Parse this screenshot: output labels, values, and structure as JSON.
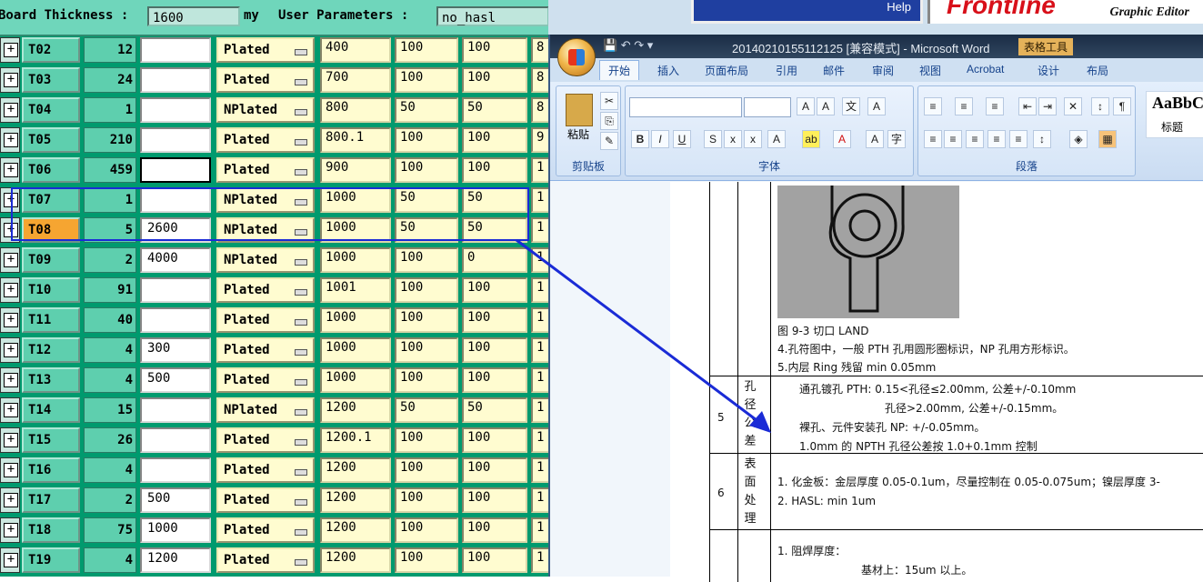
{
  "header": {
    "board_label": "Board Thickness :",
    "board_value": "1600",
    "unit": "my",
    "userparam_label": "User Parameters :",
    "userparam_value": "no_hasl"
  },
  "rows": [
    {
      "tool": "T02",
      "count": "12",
      "val": "",
      "plated": "Plated",
      "n1": "400",
      "n2": "100",
      "n3": "100",
      "n4": "8"
    },
    {
      "tool": "T03",
      "count": "24",
      "val": "",
      "plated": "Plated",
      "n1": "700",
      "n2": "100",
      "n3": "100",
      "n4": "8"
    },
    {
      "tool": "T04",
      "count": "1",
      "val": "",
      "plated": "NPlated",
      "n1": "800",
      "n2": "50",
      "n3": "50",
      "n4": "8"
    },
    {
      "tool": "T05",
      "count": "210",
      "val": "",
      "plated": "Plated",
      "n1": "800.1",
      "n2": "100",
      "n3": "100",
      "n4": "9"
    },
    {
      "tool": "T06",
      "count": "459",
      "val": "",
      "plated": "Plated",
      "n1": "900",
      "n2": "100",
      "n3": "100",
      "n4": "1"
    },
    {
      "tool": "T07",
      "count": "1",
      "val": "",
      "plated": "NPlated",
      "n1": "1000",
      "n2": "50",
      "n3": "50",
      "n4": "1"
    },
    {
      "tool": "T08",
      "count": "5",
      "val": "2600",
      "plated": "NPlated",
      "n1": "1000",
      "n2": "50",
      "n3": "50",
      "n4": "1"
    },
    {
      "tool": "T09",
      "count": "2",
      "val": "4000",
      "plated": "NPlated",
      "n1": "1000",
      "n2": "100",
      "n3": "0",
      "n4": "1"
    },
    {
      "tool": "T10",
      "count": "91",
      "val": "",
      "plated": "Plated",
      "n1": "1001",
      "n2": "100",
      "n3": "100",
      "n4": "1"
    },
    {
      "tool": "T11",
      "count": "40",
      "val": "",
      "plated": "Plated",
      "n1": "1000",
      "n2": "100",
      "n3": "100",
      "n4": "1"
    },
    {
      "tool": "T12",
      "count": "4",
      "val": "300",
      "plated": "Plated",
      "n1": "1000",
      "n2": "100",
      "n3": "100",
      "n4": "1"
    },
    {
      "tool": "T13",
      "count": "4",
      "val": "500",
      "plated": "Plated",
      "n1": "1000",
      "n2": "100",
      "n3": "100",
      "n4": "1"
    },
    {
      "tool": "T14",
      "count": "15",
      "val": "",
      "plated": "NPlated",
      "n1": "1200",
      "n2": "50",
      "n3": "50",
      "n4": "1"
    },
    {
      "tool": "T15",
      "count": "26",
      "val": "",
      "plated": "Plated",
      "n1": "1200.1",
      "n2": "100",
      "n3": "100",
      "n4": "1"
    },
    {
      "tool": "T16",
      "count": "4",
      "val": "",
      "plated": "Plated",
      "n1": "1200",
      "n2": "100",
      "n3": "100",
      "n4": "1"
    },
    {
      "tool": "T17",
      "count": "2",
      "val": "500",
      "plated": "Plated",
      "n1": "1200",
      "n2": "100",
      "n3": "100",
      "n4": "1"
    },
    {
      "tool": "T18",
      "count": "75",
      "val": "1000",
      "plated": "Plated",
      "n1": "1200",
      "n2": "100",
      "n3": "100",
      "n4": "1"
    },
    {
      "tool": "T19",
      "count": "4",
      "val": "1200",
      "plated": "Plated",
      "n1": "1200",
      "n2": "100",
      "n3": "100",
      "n4": "1"
    }
  ],
  "top_right": {
    "help": "Help",
    "brand": "Frontline",
    "editor": "Graphic Editor"
  },
  "word": {
    "title": "20140210155112125 [兼容模式] - Microsoft Word",
    "table_tools": "表格工具",
    "tabs": [
      "开始",
      "插入",
      "页面布局",
      "引用",
      "邮件",
      "审阅",
      "视图",
      "Acrobat",
      "设计",
      "布局"
    ],
    "groups": {
      "clipboard": "剪贴板",
      "font": "字体",
      "paragraph": "段落",
      "paste": "粘贴",
      "style_sample": "AaBbC",
      "style_name": "标题"
    },
    "doc": {
      "fig_caption": "图 9-3 切口 LAND",
      "line4": "4.孔符图中，一般 PTH 孔用圆形圈标识，NP 孔用方形标识。",
      "line5": "5.内层 Ring 残留 min 0.05mm",
      "row5_no": "5",
      "row5_title": "孔径公差",
      "row5_l1": "通孔镀孔 PTH: 0.15<孔径≤2.00mm, 公差+/-0.10mm",
      "row5_l2": "孔径>2.00mm, 公差+/-0.15mm。",
      "row5_l3": "裸孔、元件安装孔 NP: +/-0.05mm。",
      "row5_l4": "1.0mm 的 NPTH 孔径公差按 1.0+0.1mm 控制",
      "row6_no": "6",
      "row6_title": "表面处理",
      "row6_l1": "1.  化金板：金层厚度 0.05-0.1um，尽量控制在 0.05-0.075um；镍层厚度 3-",
      "row6_l2": "2.  HASL: min 1um",
      "row7_l1": "1.  阻焊厚度：",
      "row7_l2": "基材上：15um 以上。"
    }
  },
  "colors": {
    "panel": "#009a6e",
    "cell": "#5ecfae",
    "selected": "#f6a531",
    "arrow": "#1a2bd6"
  }
}
